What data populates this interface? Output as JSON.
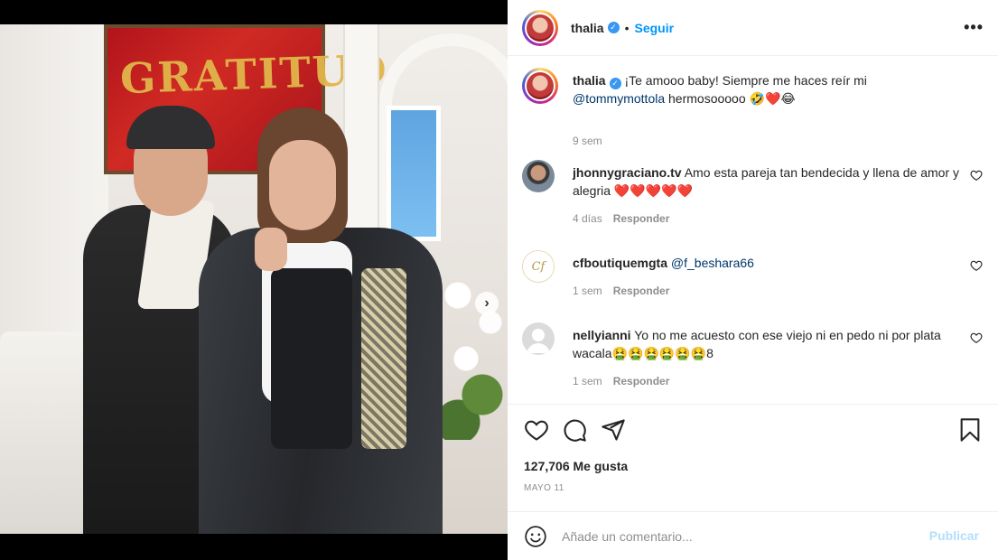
{
  "post": {
    "carousel": {
      "slide_count": 5,
      "active_index": 0
    },
    "next_glyph": "›"
  },
  "header": {
    "username": "thalia",
    "verified_glyph": "✓",
    "separator": "•",
    "follow_label": "Seguir",
    "more_label": "•••"
  },
  "caption": {
    "username": "thalia",
    "text_before": "¡Te amooo baby! Siempre me haces reír mi",
    "mention": "@tommymottola",
    "text_after": "hermosooooo 🤣❤️😂",
    "time": "9 sem"
  },
  "comments": [
    {
      "username": "jhonnygraciano.tv",
      "text": "Amo esta pareja tan bendecida y llena de amor y alegria ❤️❤️❤️❤️❤️",
      "time": "4 días",
      "reply_label": "Responder"
    },
    {
      "username": "cfboutiquemgta",
      "mention": "@f_beshara66",
      "avatar_text": "Cf",
      "time": "1 sem",
      "reply_label": "Responder"
    },
    {
      "username": "nellyianni",
      "text": "Yo no me acuesto con ese viejo ni en pedo ni por plata wacala🤮🤮🤮🤮🤮🤮8",
      "time": "1 sem",
      "reply_label": "Responder"
    }
  ],
  "actions": {
    "likes": "127,706 Me gusta",
    "date": "MAYO 11"
  },
  "composer": {
    "placeholder": "Añade un comentario...",
    "publish_label": "Publicar"
  },
  "colors": {
    "accent": "#0095f6",
    "verified": "#3897f0",
    "heart_red": "#ed4956",
    "muted": "#8e8e8e",
    "publish_disabled": "#b2dffc"
  }
}
